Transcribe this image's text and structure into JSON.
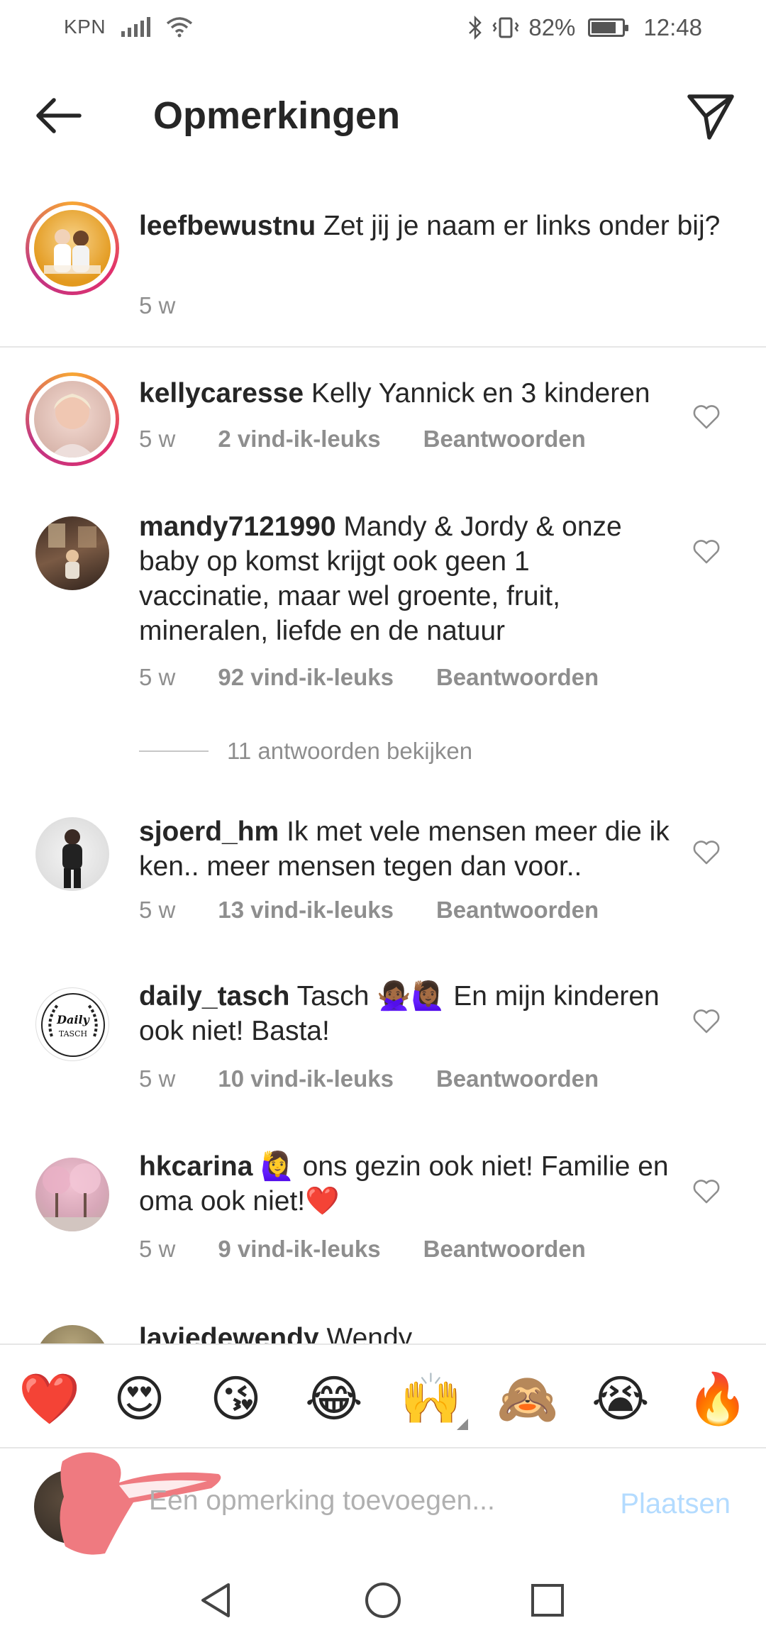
{
  "status_bar": {
    "carrier": "KPN",
    "battery": "82%",
    "time": "12:48",
    "battery_level": 0.82
  },
  "header": {
    "title": "Opmerkingen"
  },
  "caption": {
    "username": "leefbewustnu",
    "text": "Zet jij je naam er links onder bij?",
    "time": "5 w"
  },
  "comments": [
    {
      "username": "kellycaresse",
      "text": "Kelly Yannick en 3 kinderen",
      "time": "5 w",
      "likes": "2 vind-ik-leuks",
      "reply": "Beantwoorden"
    },
    {
      "username": "mandy7121990",
      "text": "Mandy & Jordy & onze baby op komst krijgt ook geen 1 vaccinatie, maar wel groente, fruit, mineralen, liefde en de natuur",
      "time": "5 w",
      "likes": "92 vind-ik-leuks",
      "reply": "Beantwoorden"
    },
    {
      "username": "sjoerd_hm",
      "text": "Ik met vele mensen meer die ik ken.. meer mensen tegen dan voor..",
      "time": "5 w",
      "likes": "13 vind-ik-leuks",
      "reply": "Beantwoorden"
    },
    {
      "username": "daily_tasch",
      "text": "Tasch 🙅🏾‍♀️🙋🏾‍♀️ En mijn kinderen ook niet! Basta!",
      "time": "5 w",
      "likes": "10 vind-ik-leuks",
      "reply": "Beantwoorden"
    },
    {
      "username": "hkcarina",
      "text": "🙋‍♀️ ons gezin ook niet! Familie en oma ook niet!❤️",
      "time": "5 w",
      "likes": "9 vind-ik-leuks",
      "reply": "Beantwoorden"
    },
    {
      "username": "laviedewendy",
      "text": "Wendy"
    }
  ],
  "replies_link": "11 antwoorden bekijken",
  "daily_tasch_logo": "Daily TASCH",
  "emoji_bar": [
    "❤️",
    "😍",
    "😘",
    "😂",
    "🙌",
    "🙈",
    "😭",
    "🔥"
  ],
  "input": {
    "placeholder": "Een opmerking toevoegen...",
    "post_label": "Plaatsen"
  },
  "colors": {
    "accent": "#3897f0",
    "post_disabled": "#b3dbff",
    "meta_gray": "#8e8e8e"
  }
}
